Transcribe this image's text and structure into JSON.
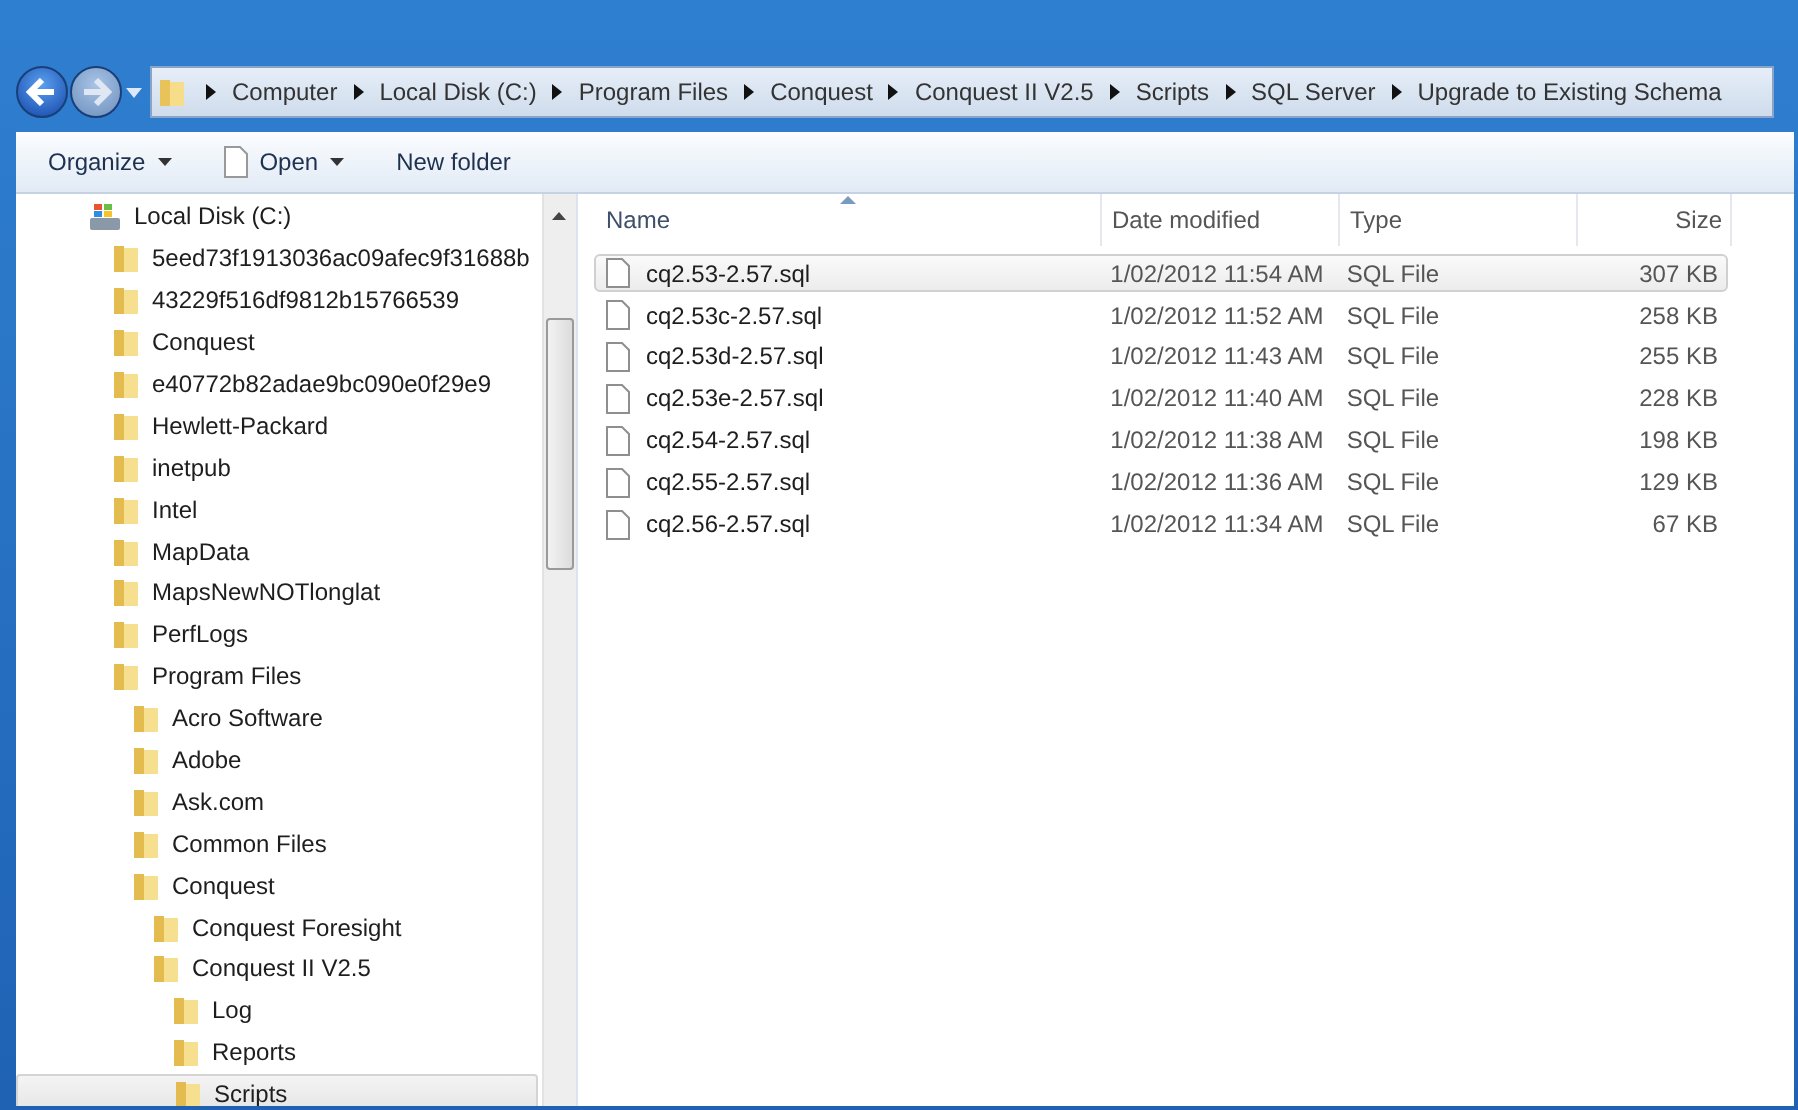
{
  "address_bar": {
    "segments": [
      "Computer",
      "Local Disk (C:)",
      "Program Files",
      "Conquest",
      "Conquest II V2.5",
      "Scripts",
      "SQL Server",
      "Upgrade to Existing Schema"
    ]
  },
  "toolbar": {
    "buttons": [
      {
        "label": "Organize",
        "kind": "menu"
      },
      {
        "label": "Open",
        "kind": "file-menu"
      },
      {
        "label": "New folder",
        "kind": "plain"
      }
    ]
  },
  "sidebar": {
    "items": [
      {
        "label": "Local Disk (C:)",
        "kind": "drive",
        "selected": false,
        "children": [
          {
            "label": "5eed73f1913036ac09afec9f31688b",
            "kind": "folder",
            "selected": false
          },
          {
            "label": "43229f516df9812b15766539",
            "kind": "folder",
            "selected": false
          },
          {
            "label": "Conquest",
            "kind": "folder",
            "selected": false
          },
          {
            "label": "e40772b82adae9bc090e0f29e9",
            "kind": "folder",
            "selected": false
          },
          {
            "label": "Hewlett-Packard",
            "kind": "folder",
            "selected": false
          },
          {
            "label": "inetpub",
            "kind": "folder",
            "selected": false
          },
          {
            "label": "Intel",
            "kind": "folder",
            "selected": false
          },
          {
            "label": "MapData",
            "kind": "folder",
            "selected": false
          },
          {
            "label": "MapsNewNOTlonglat",
            "kind": "folder",
            "selected": false
          },
          {
            "label": "PerfLogs",
            "kind": "folder",
            "selected": false
          },
          {
            "label": "Program Files",
            "kind": "folder",
            "selected": false,
            "children": [
              {
                "label": "Acro Software",
                "kind": "folder",
                "selected": false
              },
              {
                "label": "Adobe",
                "kind": "folder",
                "selected": false
              },
              {
                "label": "Ask.com",
                "kind": "folder",
                "selected": false
              },
              {
                "label": "Common Files",
                "kind": "folder",
                "selected": false
              },
              {
                "label": "Conquest",
                "kind": "folder",
                "selected": false,
                "children": [
                  {
                    "label": "Conquest Foresight",
                    "kind": "folder",
                    "selected": false
                  },
                  {
                    "label": "Conquest II V2.5",
                    "kind": "folder",
                    "selected": false,
                    "children": [
                      {
                        "label": "Log",
                        "kind": "folder",
                        "selected": false
                      },
                      {
                        "label": "Reports",
                        "kind": "folder",
                        "selected": false
                      },
                      {
                        "label": "Scripts",
                        "kind": "folder",
                        "selected": true
                      }
                    ]
                  }
                ]
              }
            ]
          }
        ]
      }
    ]
  },
  "file_list": {
    "columns": [
      {
        "label": "Name",
        "sorted": true
      },
      {
        "label": "Date modified",
        "sorted": false
      },
      {
        "label": "Type",
        "sorted": false
      },
      {
        "label": "Size",
        "sorted": false
      }
    ],
    "rows": [
      {
        "name": "cq2.53-2.57.sql",
        "date": "1/02/2012 11:54 AM",
        "type": "SQL File",
        "size": "307 KB",
        "selected": true
      },
      {
        "name": "cq2.53c-2.57.sql",
        "date": "1/02/2012 11:52 AM",
        "type": "SQL File",
        "size": "258 KB",
        "selected": false
      },
      {
        "name": "cq2.53d-2.57.sql",
        "date": "1/02/2012 11:43 AM",
        "type": "SQL File",
        "size": "255 KB",
        "selected": false
      },
      {
        "name": "cq2.53e-2.57.sql",
        "date": "1/02/2012 11:40 AM",
        "type": "SQL File",
        "size": "228 KB",
        "selected": false
      },
      {
        "name": "cq2.54-2.57.sql",
        "date": "1/02/2012 11:38 AM",
        "type": "SQL File",
        "size": "198 KB",
        "selected": false
      },
      {
        "name": "cq2.55-2.57.sql",
        "date": "1/02/2012 11:36 AM",
        "type": "SQL File",
        "size": "129 KB",
        "selected": false
      },
      {
        "name": "cq2.56-2.57.sql",
        "date": "1/02/2012 11:34 AM",
        "type": "SQL File",
        "size": "67 KB",
        "selected": false
      }
    ]
  }
}
